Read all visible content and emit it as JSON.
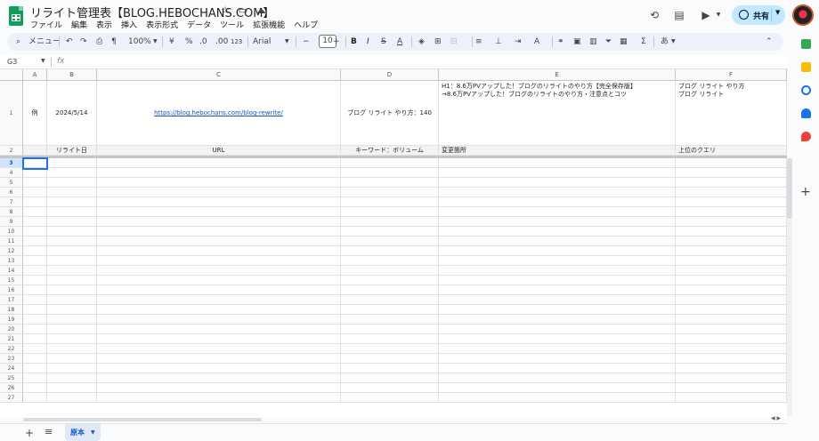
{
  "doc": {
    "title": "リライト管理表【BLOG.HEBOCHANS.COM】",
    "menu": [
      "ファイル",
      "編集",
      "表示",
      "挿入",
      "表示形式",
      "データ",
      "ツール",
      "拡張機能",
      "ヘルプ"
    ],
    "share_label": "共有"
  },
  "toolbar": {
    "search_label": "メニュー",
    "zoom": "100%",
    "currency": "¥",
    "percent": "%",
    "dec_decrease": ".0",
    "dec_increase": ".00",
    "number_format": "123",
    "font": "Arial",
    "font_size": "10",
    "bold": "B",
    "italic": "I",
    "input_tools": "あ"
  },
  "formula_bar": {
    "cell_ref": "G3",
    "fx": "fx"
  },
  "grid": {
    "columns": [
      "A",
      "B",
      "C",
      "D",
      "E",
      "F"
    ],
    "row1": {
      "num": "1",
      "a": "例",
      "b": "2024/5/14",
      "c": "https://blog.hebochans.com/blog-rewrite/",
      "d": "ブログ リライト やり方：140",
      "e_line1": "H1：8.6万PVアップした！ブログのリライトのやり方【完全保存版】",
      "e_line2": "→8.6万PVアップした！ブログのリライトのやり方・注意点とコツ",
      "f_line1": "ブログ リライト やり方",
      "f_line2": "ブログ リライト"
    },
    "row2": {
      "num": "2",
      "b": "リライト日",
      "c": "URL",
      "d": "キーワード：ボリューム",
      "e": "変更箇所",
      "f": "上位のクエリ"
    },
    "row_numbers": [
      "3",
      "4",
      "5",
      "6",
      "7",
      "8",
      "9",
      "10",
      "11",
      "12",
      "13",
      "14",
      "15",
      "16",
      "17",
      "18",
      "19",
      "20",
      "21",
      "22",
      "23",
      "24",
      "25",
      "26",
      "27"
    ]
  },
  "sheet": {
    "tab_label": "原本"
  },
  "colors": {
    "accent": "#1a73e8",
    "share_bg": "#c2e7ff",
    "link": "#1155cc",
    "sheets_green": "#0f9d58"
  }
}
